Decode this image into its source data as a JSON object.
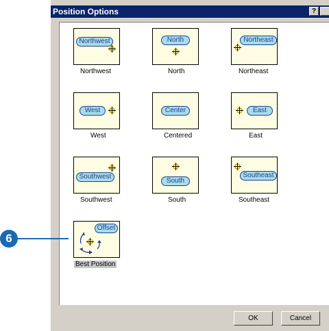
{
  "window": {
    "title": "Position Options",
    "help_glyph": "?",
    "close_glyph": "x"
  },
  "positions": [
    {
      "label": "Northwest",
      "pill": "Northwest"
    },
    {
      "label": "North",
      "pill": "North"
    },
    {
      "label": "Northeast",
      "pill": "Northeast"
    },
    {
      "label": "West",
      "pill": "West"
    },
    {
      "label": "Centered",
      "pill": "Center"
    },
    {
      "label": "East",
      "pill": "East"
    },
    {
      "label": "Southwest",
      "pill": "Southwest"
    },
    {
      "label": "South",
      "pill": "South"
    },
    {
      "label": "Southeast",
      "pill": "Southeast"
    },
    {
      "label": "Best Position",
      "pill": "Offset",
      "selected": true
    }
  ],
  "buttons": {
    "ok": "OK",
    "cancel": "Cancel"
  },
  "callout": {
    "number": "6"
  },
  "colors": {
    "titlebar": "#0a246a",
    "pill": "#a8dcea",
    "tile": "#fefde3",
    "callout": "#1a69b3",
    "cross": "#c8a000"
  }
}
